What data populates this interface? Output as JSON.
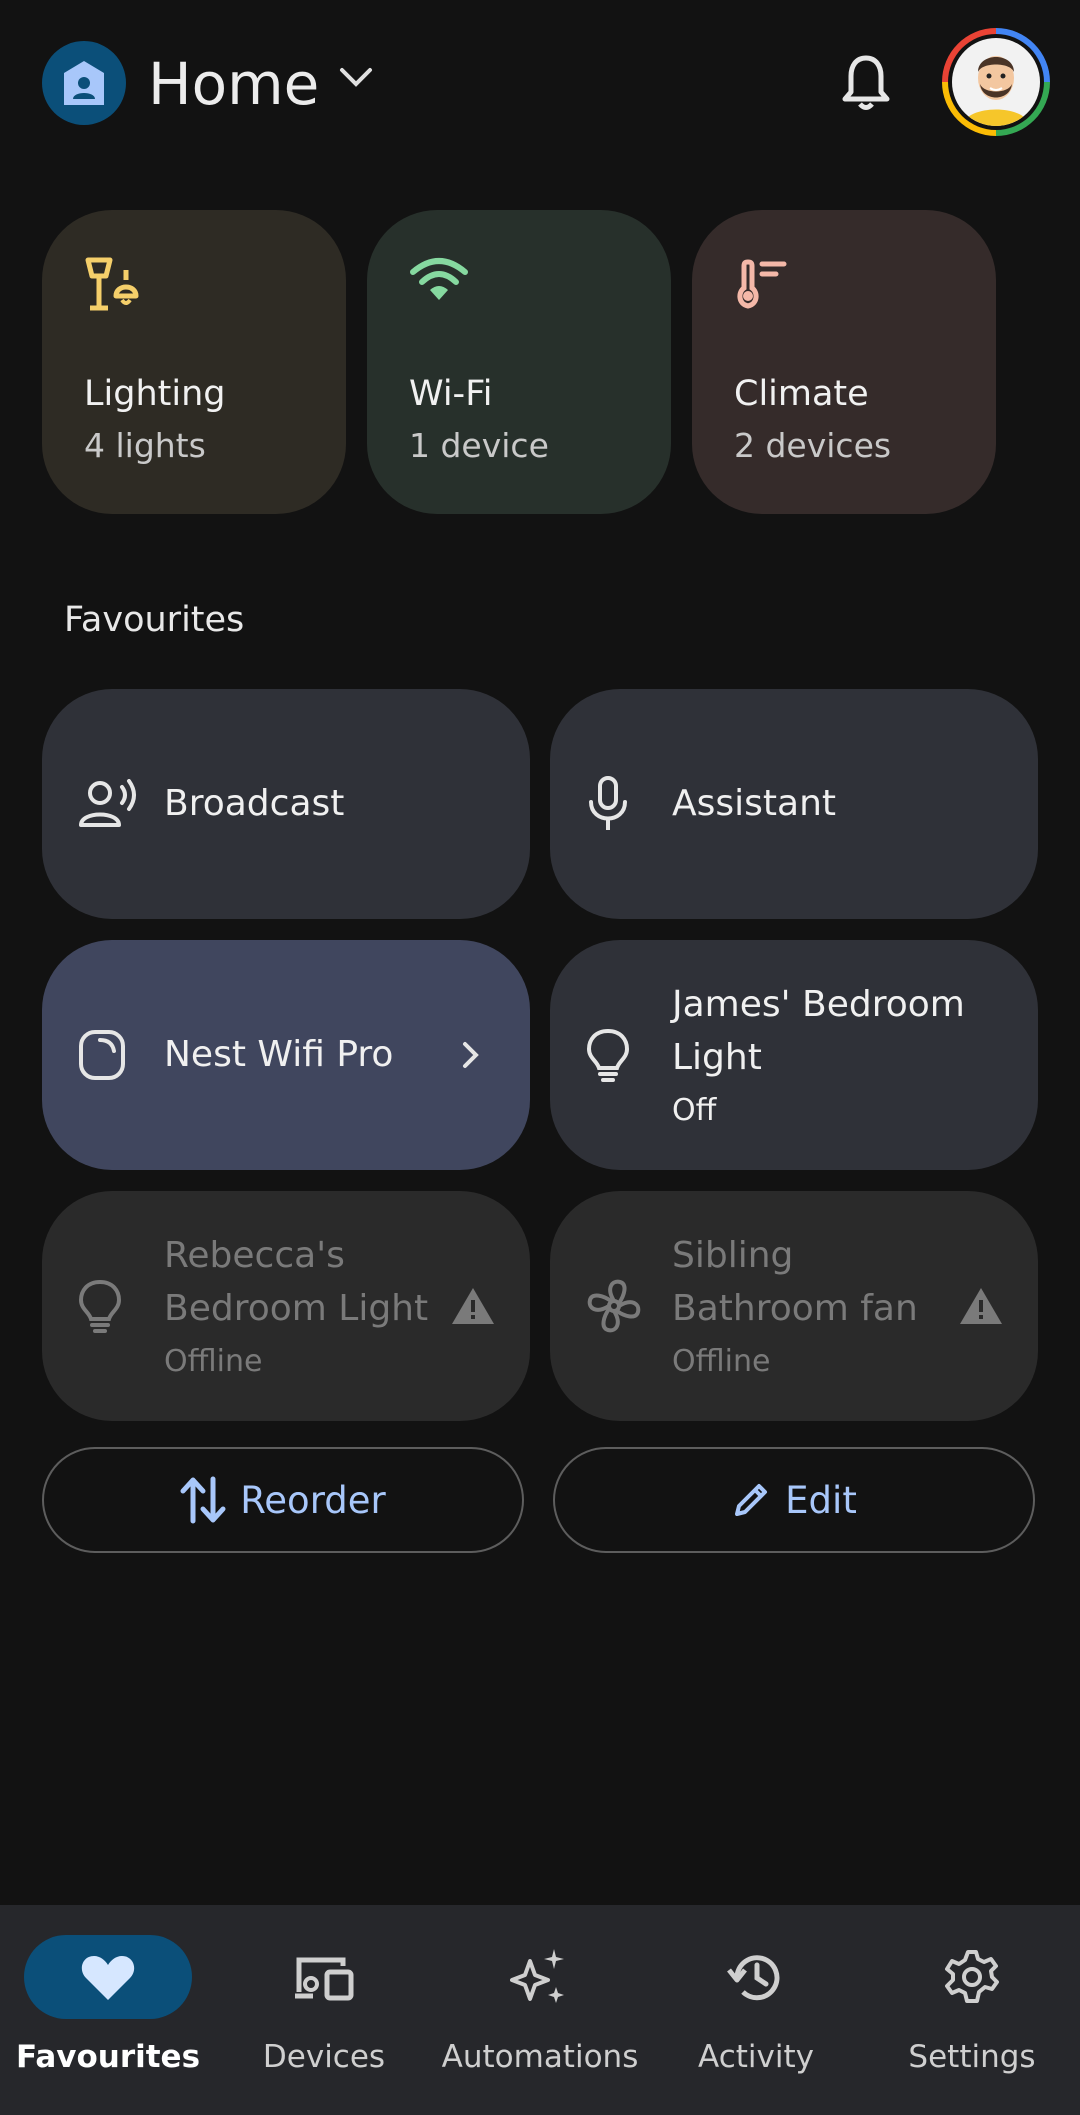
{
  "header": {
    "home_title": "Home"
  },
  "categories": [
    {
      "title": "Lighting",
      "subtitle": "4 lights",
      "icon": "lamp-icon",
      "bg": "#2e2b24",
      "accent": "#f5cf6a"
    },
    {
      "title": "Wi-Fi",
      "subtitle": "1 device",
      "icon": "wifi-icon",
      "bg": "#27302b",
      "accent": "#86d9a0"
    },
    {
      "title": "Climate",
      "subtitle": "2 devices",
      "icon": "thermostat-icon",
      "bg": "#352b2a",
      "accent": "#f4b8a8"
    }
  ],
  "favourites": {
    "heading": "Favourites",
    "tiles": [
      {
        "label": "Broadcast",
        "icon": "broadcast-icon"
      },
      {
        "label": "Assistant",
        "icon": "microphone-icon"
      },
      {
        "label": "Nest Wifi Pro",
        "icon": "router-icon"
      },
      {
        "label_line1": "James' Bedroom",
        "label_line2": "Light",
        "status": "Off",
        "icon": "bulb-icon"
      },
      {
        "label_line1": "Rebecca's",
        "label_line2": "Bedroom Light",
        "status": "Offline",
        "icon": "bulb-icon"
      },
      {
        "label_line1": "Sibling",
        "label_line2": "Bathroom fan",
        "status": "Offline",
        "icon": "fan-icon"
      }
    ]
  },
  "actions": {
    "reorder": "Reorder",
    "edit": "Edit"
  },
  "nav": [
    {
      "label": "Favourites",
      "icon": "heart-icon",
      "active": true
    },
    {
      "label": "Devices",
      "icon": "devices-icon"
    },
    {
      "label": "Automations",
      "icon": "sparkle-icon"
    },
    {
      "label": "Activity",
      "icon": "history-icon"
    },
    {
      "label": "Settings",
      "icon": "gear-icon"
    }
  ],
  "colors": {
    "background": "#121212",
    "accent_blue": "#a8c7fa",
    "active_nav": "#0b4f79"
  }
}
